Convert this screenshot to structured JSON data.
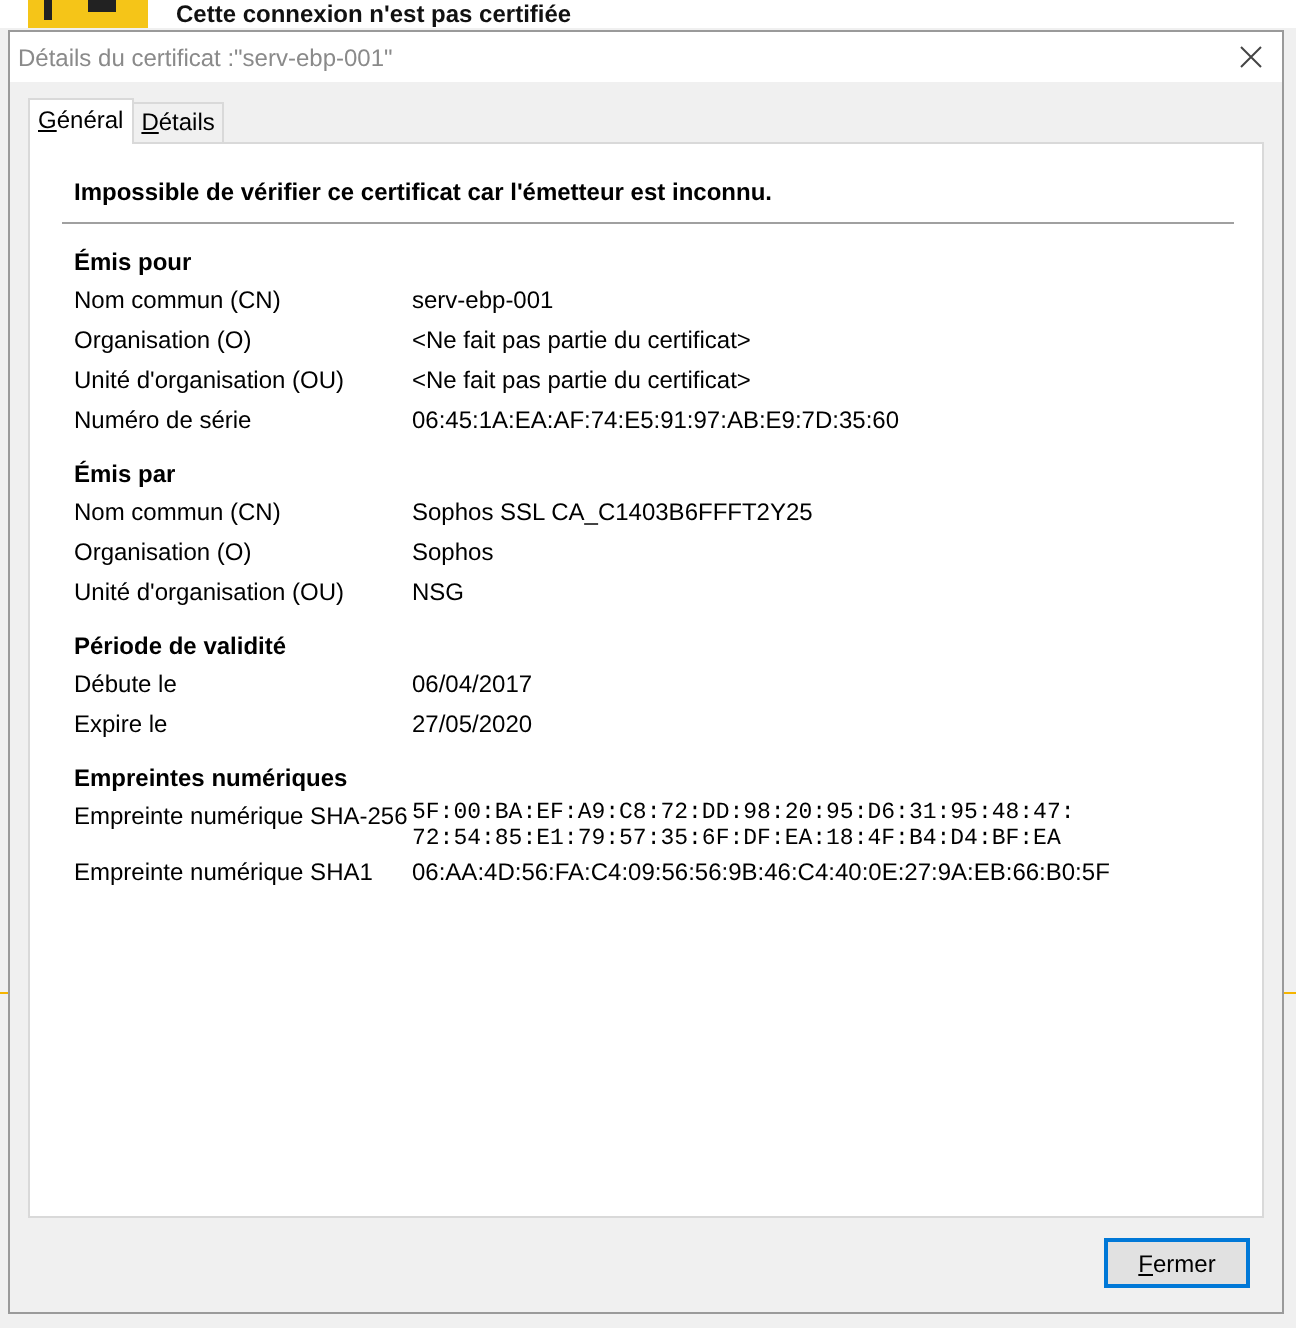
{
  "background_page": {
    "title": "Cette connexion n'est pas certifiée"
  },
  "window": {
    "title": "Détails du certificat :\"serv-ebp-001\""
  },
  "tabs": [
    {
      "label": "Général",
      "selected": true
    },
    {
      "label": "Détails",
      "selected": false
    }
  ],
  "message": "Impossible de vérifier ce certificat car l'émetteur est inconnu.",
  "sections": [
    {
      "heading": "Émis pour",
      "rows": [
        {
          "kind": "text",
          "label": "Nom commun (CN)",
          "value": "serv-ebp-001"
        },
        {
          "kind": "text",
          "label": "Organisation (O)",
          "value": "<Ne fait pas partie du certificat>"
        },
        {
          "kind": "text",
          "label": "Unité d'organisation (OU)",
          "value": "<Ne fait pas partie du certificat>"
        },
        {
          "kind": "text",
          "label": "Numéro de série",
          "value": "06:45:1A:EA:AF:74:E5:91:97:AB:E9:7D:35:60"
        }
      ]
    },
    {
      "heading": "Émis par",
      "rows": [
        {
          "kind": "text",
          "label": "Nom commun (CN)",
          "value": "Sophos SSL CA_C1403B6FFFT2Y25"
        },
        {
          "kind": "text",
          "label": "Organisation (O)",
          "value": "Sophos"
        },
        {
          "kind": "text",
          "label": "Unité d'organisation (OU)",
          "value": "NSG"
        }
      ]
    },
    {
      "heading": "Période de validité",
      "rows": [
        {
          "kind": "text",
          "label": "Débute le",
          "value": "06/04/2017"
        },
        {
          "kind": "text",
          "label": "Expire le",
          "value": "27/05/2020"
        }
      ]
    },
    {
      "heading": "Empreintes numériques",
      "rows": [
        {
          "kind": "mono",
          "label": "Empreinte numérique SHA-256",
          "value": "5F:00:BA:EF:A9:C8:72:DD:98:20:95:D6:31:95:48:47:\n72:54:85:E1:79:57:35:6F:DF:EA:18:4F:B4:D4:BF:EA"
        },
        {
          "kind": "text",
          "label": "Empreinte numérique SHA1",
          "value": "06:AA:4D:56:FA:C4:09:56:56:9B:46:C4:40:0E:27:9A:EB:66:B0:5F"
        }
      ]
    }
  ],
  "buttons": [
    {
      "label": "Fermer"
    }
  ]
}
